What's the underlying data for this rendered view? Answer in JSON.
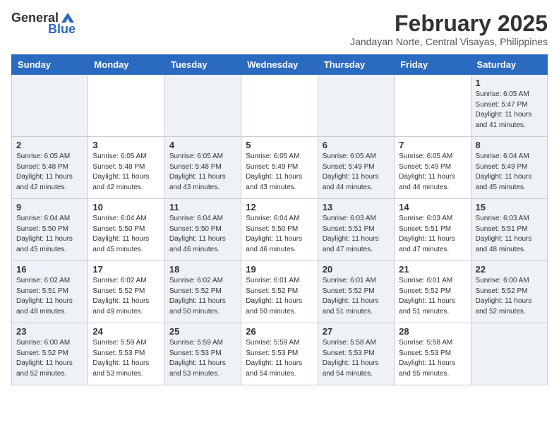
{
  "header": {
    "logo_general": "General",
    "logo_blue": "Blue",
    "month_year": "February 2025",
    "location": "Jandayan Norte, Central Visayas, Philippines"
  },
  "calendar": {
    "days_of_week": [
      "Sunday",
      "Monday",
      "Tuesday",
      "Wednesday",
      "Thursday",
      "Friday",
      "Saturday"
    ],
    "weeks": [
      [
        {
          "day": "",
          "info": ""
        },
        {
          "day": "",
          "info": ""
        },
        {
          "day": "",
          "info": ""
        },
        {
          "day": "",
          "info": ""
        },
        {
          "day": "",
          "info": ""
        },
        {
          "day": "",
          "info": ""
        },
        {
          "day": "1",
          "info": "Sunrise: 6:05 AM\nSunset: 5:47 PM\nDaylight: 11 hours\nand 41 minutes."
        }
      ],
      [
        {
          "day": "2",
          "info": "Sunrise: 6:05 AM\nSunset: 5:48 PM\nDaylight: 11 hours\nand 42 minutes."
        },
        {
          "day": "3",
          "info": "Sunrise: 6:05 AM\nSunset: 5:48 PM\nDaylight: 11 hours\nand 42 minutes."
        },
        {
          "day": "4",
          "info": "Sunrise: 6:05 AM\nSunset: 5:48 PM\nDaylight: 11 hours\nand 43 minutes."
        },
        {
          "day": "5",
          "info": "Sunrise: 6:05 AM\nSunset: 5:49 PM\nDaylight: 11 hours\nand 43 minutes."
        },
        {
          "day": "6",
          "info": "Sunrise: 6:05 AM\nSunset: 5:49 PM\nDaylight: 11 hours\nand 44 minutes."
        },
        {
          "day": "7",
          "info": "Sunrise: 6:05 AM\nSunset: 5:49 PM\nDaylight: 11 hours\nand 44 minutes."
        },
        {
          "day": "8",
          "info": "Sunrise: 6:04 AM\nSunset: 5:49 PM\nDaylight: 11 hours\nand 45 minutes."
        }
      ],
      [
        {
          "day": "9",
          "info": "Sunrise: 6:04 AM\nSunset: 5:50 PM\nDaylight: 11 hours\nand 45 minutes."
        },
        {
          "day": "10",
          "info": "Sunrise: 6:04 AM\nSunset: 5:50 PM\nDaylight: 11 hours\nand 45 minutes."
        },
        {
          "day": "11",
          "info": "Sunrise: 6:04 AM\nSunset: 5:50 PM\nDaylight: 11 hours\nand 46 minutes."
        },
        {
          "day": "12",
          "info": "Sunrise: 6:04 AM\nSunset: 5:50 PM\nDaylight: 11 hours\nand 46 minutes."
        },
        {
          "day": "13",
          "info": "Sunrise: 6:03 AM\nSunset: 5:51 PM\nDaylight: 11 hours\nand 47 minutes."
        },
        {
          "day": "14",
          "info": "Sunrise: 6:03 AM\nSunset: 5:51 PM\nDaylight: 11 hours\nand 47 minutes."
        },
        {
          "day": "15",
          "info": "Sunrise: 6:03 AM\nSunset: 5:51 PM\nDaylight: 11 hours\nand 48 minutes."
        }
      ],
      [
        {
          "day": "16",
          "info": "Sunrise: 6:02 AM\nSunset: 5:51 PM\nDaylight: 11 hours\nand 48 minutes."
        },
        {
          "day": "17",
          "info": "Sunrise: 6:02 AM\nSunset: 5:52 PM\nDaylight: 11 hours\nand 49 minutes."
        },
        {
          "day": "18",
          "info": "Sunrise: 6:02 AM\nSunset: 5:52 PM\nDaylight: 11 hours\nand 50 minutes."
        },
        {
          "day": "19",
          "info": "Sunrise: 6:01 AM\nSunset: 5:52 PM\nDaylight: 11 hours\nand 50 minutes."
        },
        {
          "day": "20",
          "info": "Sunrise: 6:01 AM\nSunset: 5:52 PM\nDaylight: 11 hours\nand 51 minutes."
        },
        {
          "day": "21",
          "info": "Sunrise: 6:01 AM\nSunset: 5:52 PM\nDaylight: 11 hours\nand 51 minutes."
        },
        {
          "day": "22",
          "info": "Sunrise: 6:00 AM\nSunset: 5:52 PM\nDaylight: 11 hours\nand 52 minutes."
        }
      ],
      [
        {
          "day": "23",
          "info": "Sunrise: 6:00 AM\nSunset: 5:52 PM\nDaylight: 11 hours\nand 52 minutes."
        },
        {
          "day": "24",
          "info": "Sunrise: 5:59 AM\nSunset: 5:53 PM\nDaylight: 11 hours\nand 53 minutes."
        },
        {
          "day": "25",
          "info": "Sunrise: 5:59 AM\nSunset: 5:53 PM\nDaylight: 11 hours\nand 53 minutes."
        },
        {
          "day": "26",
          "info": "Sunrise: 5:59 AM\nSunset: 5:53 PM\nDaylight: 11 hours\nand 54 minutes."
        },
        {
          "day": "27",
          "info": "Sunrise: 5:58 AM\nSunset: 5:53 PM\nDaylight: 11 hours\nand 54 minutes."
        },
        {
          "day": "28",
          "info": "Sunrise: 5:58 AM\nSunset: 5:53 PM\nDaylight: 11 hours\nand 55 minutes."
        },
        {
          "day": "",
          "info": ""
        }
      ]
    ]
  }
}
